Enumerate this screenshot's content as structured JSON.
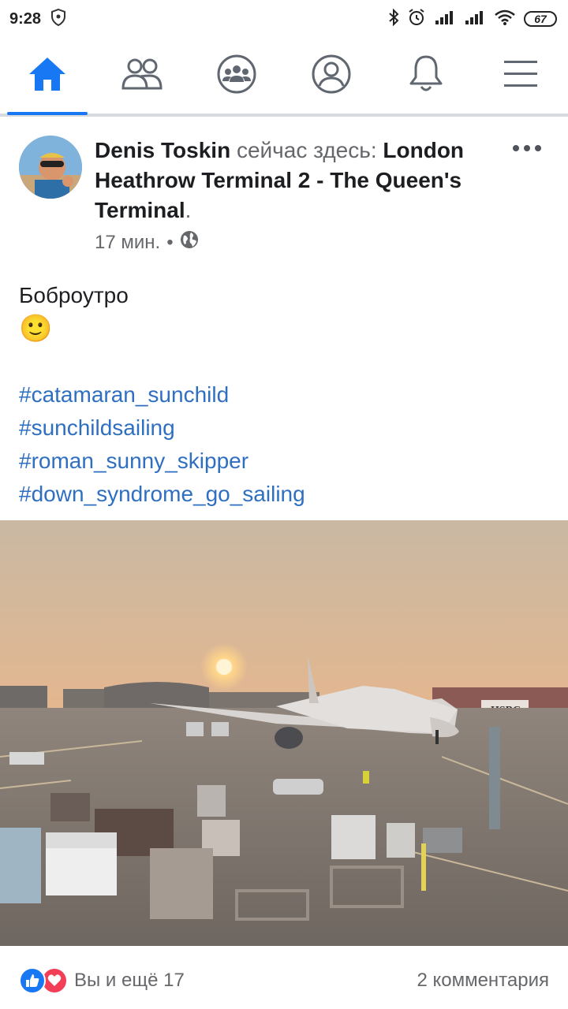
{
  "status_bar": {
    "time": "9:28",
    "battery": "67"
  },
  "nav": {
    "items": [
      {
        "name": "home",
        "active": true
      },
      {
        "name": "friends",
        "active": false
      },
      {
        "name": "groups",
        "active": false
      },
      {
        "name": "profile",
        "active": false
      },
      {
        "name": "notifications",
        "active": false
      },
      {
        "name": "menu",
        "active": false
      }
    ],
    "accent": "#1877f2"
  },
  "post": {
    "author": "Denis Toskin",
    "action": "сейчас здесь:",
    "place": "London Heathrow Terminal 2 - The Queen's Terminal",
    "period": ".",
    "time": "17 мин.",
    "separator": "•",
    "text": "Боброутро",
    "emoji": "🙂",
    "hashtags": [
      "#catamaran_sunchild",
      "#sunchildsailing",
      "#roman_sunny_skipper",
      "#down_syndrome_go_sailing"
    ],
    "hashtag_color": "#2f6fc2"
  },
  "photo": {
    "sign_text": "HSBC"
  },
  "reactions": {
    "summary": "Вы и ещё 17",
    "comments": "2 комментария"
  }
}
